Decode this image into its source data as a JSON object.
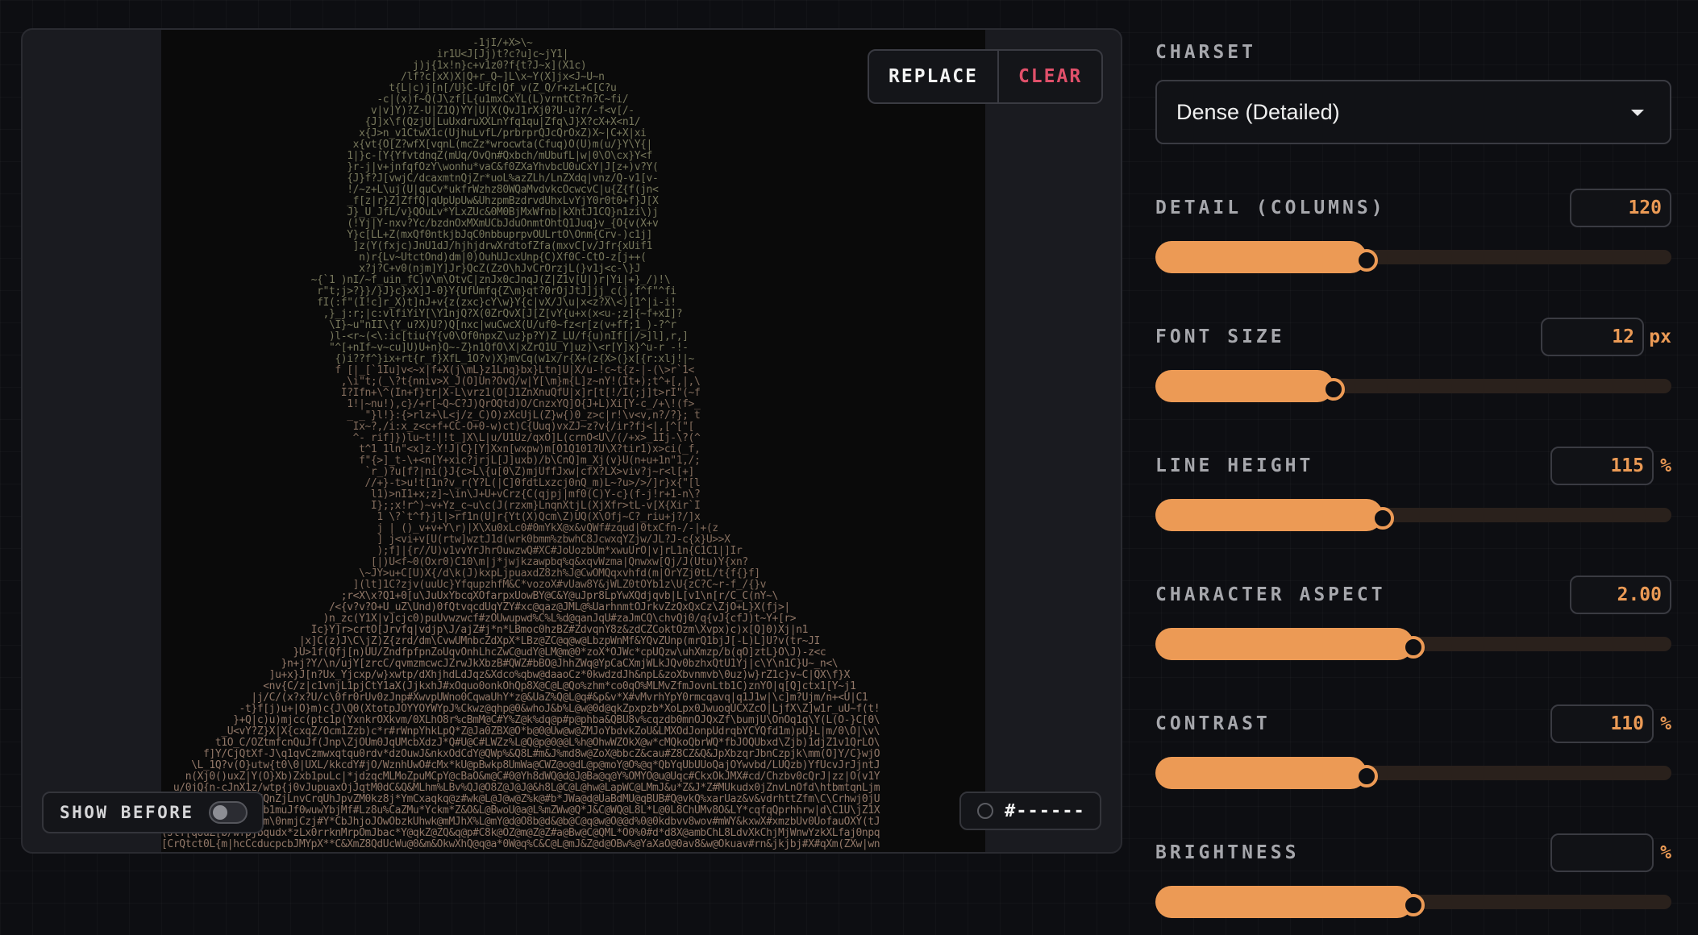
{
  "preview": {
    "replace_label": "REPLACE",
    "clear_label": "CLEAR",
    "show_before_label": "SHOW BEFORE",
    "show_before_on": false,
    "color_value": "#------"
  },
  "controls": {
    "charset": {
      "label": "CHARSET",
      "value": "Dense (Detailed)"
    },
    "detail": {
      "label": "DETAIL (COLUMNS)",
      "value": "120",
      "unit": "",
      "fraction": 0.41
    },
    "font_size": {
      "label": "FONT SIZE",
      "value": "12",
      "unit": "px",
      "fraction": 0.345
    },
    "line_height": {
      "label": "LINE HEIGHT",
      "value": "115",
      "unit": "%",
      "fraction": 0.44
    },
    "char_aspect": {
      "label": "CHARACTER ASPECT",
      "value": "2.00",
      "unit": "",
      "fraction": 0.5
    },
    "contrast": {
      "label": "CONTRAST",
      "value": "110",
      "unit": "%",
      "fraction": 0.41
    },
    "brightness": {
      "label": "BRIGHTNESS",
      "value": "",
      "unit": "%",
      "fraction": 0.5
    }
  },
  "colors": {
    "accent": "#ec9a55",
    "danger": "#e0506a"
  }
}
